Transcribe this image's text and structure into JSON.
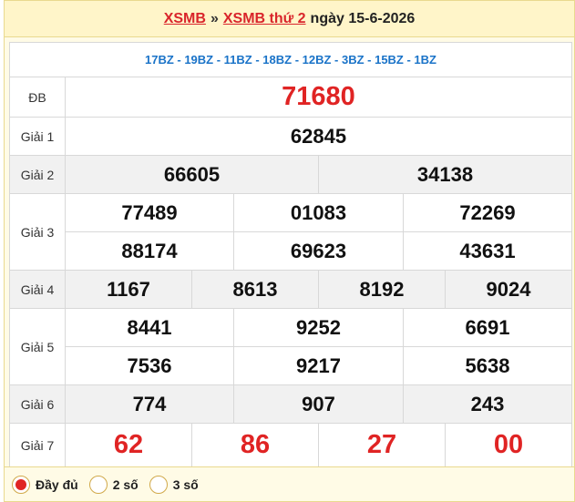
{
  "header": {
    "link1": "XSMB",
    "separator": "»",
    "link2": "XSMB thứ 2",
    "date_text": "ngày 15-6-2026"
  },
  "codes": "17BZ - 19BZ - 11BZ - 18BZ - 12BZ - 3BZ - 15BZ - 1BZ",
  "prizes": {
    "db": {
      "label": "ĐB",
      "values": [
        "71680"
      ]
    },
    "g1": {
      "label": "Giải 1",
      "values": [
        "62845"
      ]
    },
    "g2": {
      "label": "Giải 2",
      "values": [
        "66605",
        "34138"
      ]
    },
    "g3": {
      "label": "Giải 3",
      "values": [
        "77489",
        "01083",
        "72269",
        "88174",
        "69623",
        "43631"
      ]
    },
    "g4": {
      "label": "Giải 4",
      "values": [
        "1167",
        "8613",
        "8192",
        "9024"
      ]
    },
    "g5": {
      "label": "Giải 5",
      "values": [
        "8441",
        "9252",
        "6691",
        "7536",
        "9217",
        "5638"
      ]
    },
    "g6": {
      "label": "Giải 6",
      "values": [
        "774",
        "907",
        "243"
      ]
    },
    "g7": {
      "label": "Giải 7",
      "values": [
        "62",
        "86",
        "27",
        "00"
      ]
    }
  },
  "footer": {
    "options": [
      {
        "label": "Đầy đủ",
        "selected": true
      },
      {
        "label": "2 số",
        "selected": false
      },
      {
        "label": "3 số",
        "selected": false
      }
    ]
  },
  "colors": {
    "accent_red": "#e02424",
    "code_blue": "#1a73c8",
    "header_bg": "#fff5c9"
  }
}
